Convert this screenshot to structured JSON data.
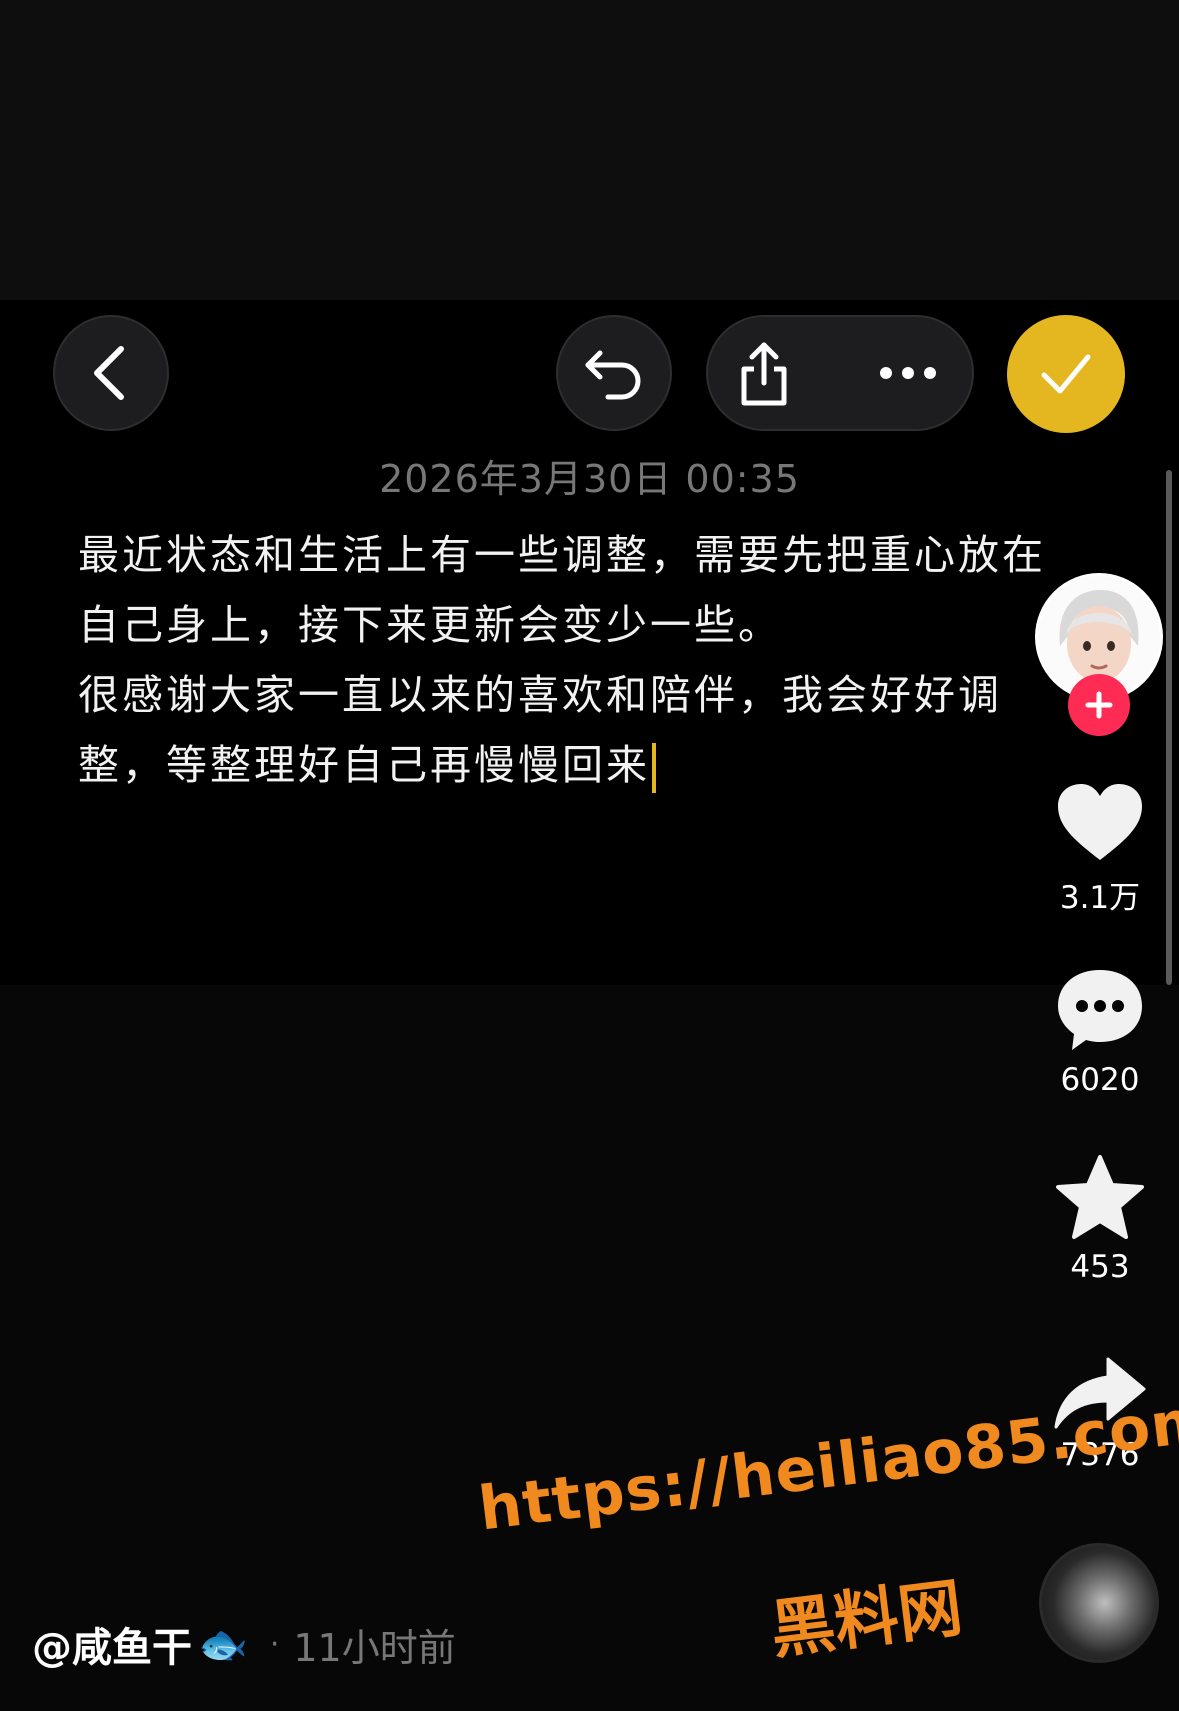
{
  "note": {
    "date": "2026年3月30日 00:35",
    "lines": [
      "最近状态和生活上有一些调整，需要先把重心放在",
      "自己身上，接下来更新会变少一些。",
      "很感谢大家一直以来的喜欢和陪伴，我会好好调",
      "整，等整理好自己再慢慢回来"
    ]
  },
  "toolbar": {
    "icons": [
      "back-icon",
      "undo-icon",
      "share-icon",
      "more-icon",
      "check-icon"
    ],
    "accent_color": "#e4b721"
  },
  "side_actions": {
    "likes": "3.1万",
    "comments": "6020",
    "favorites": "453",
    "shares": "7376"
  },
  "footer": {
    "author": "@咸鱼干",
    "author_emoji": "🐟",
    "time_ago": "11小时前"
  },
  "watermark": {
    "url": "https://heiliao85.com",
    "text": "黑料网"
  }
}
